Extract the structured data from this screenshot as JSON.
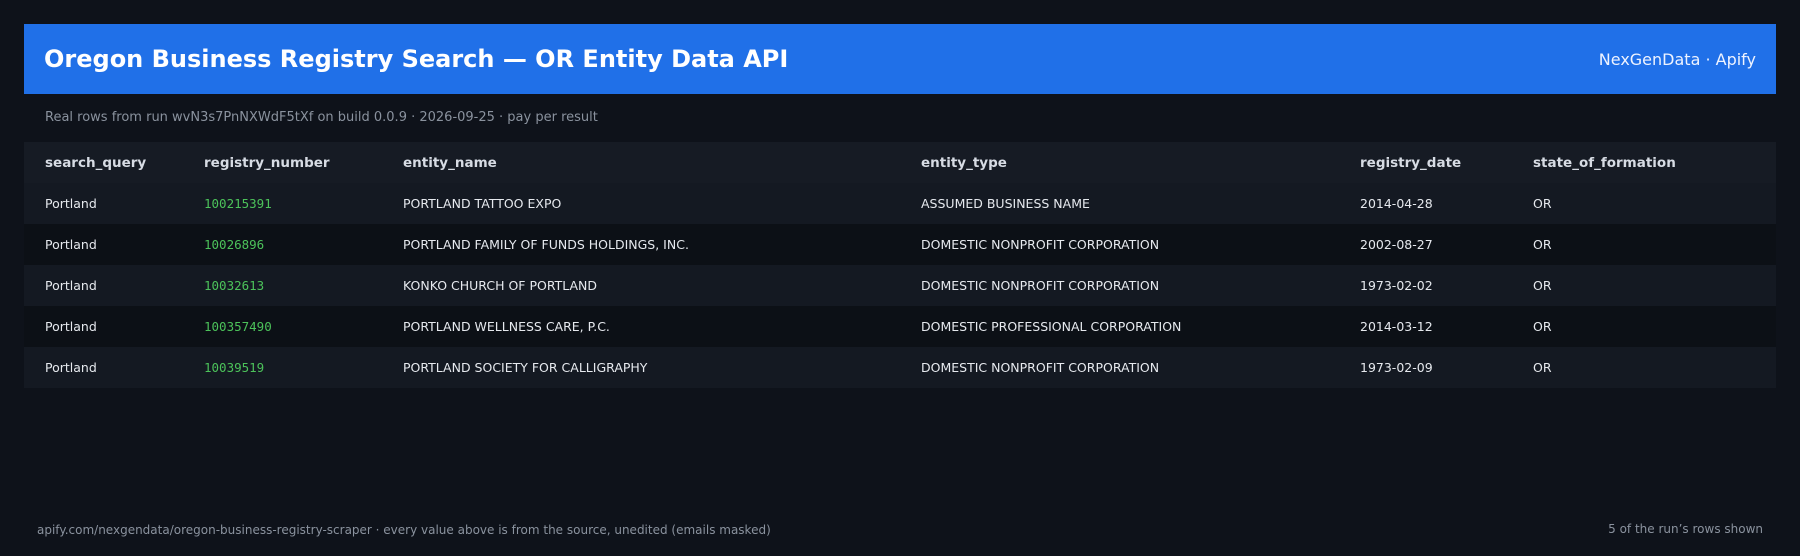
{
  "header": {
    "title": "Oregon Business Registry Search — OR Entity Data API",
    "brand": "NexGenData · Apify"
  },
  "subtitle": "Real rows from run wvN3s7PnNXWdF5tXf on build 0.0.9 · 2026-09-25 · pay per result",
  "table": {
    "columns": [
      "search_query",
      "registry_number",
      "entity_name",
      "entity_type",
      "registry_date",
      "state_of_formation"
    ],
    "rows": [
      [
        "Portland",
        "100215391",
        "PORTLAND TATTOO EXPO",
        "ASSUMED BUSINESS NAME",
        "2014-04-28",
        "OR"
      ],
      [
        "Portland",
        "10026896",
        "PORTLAND FAMILY OF FUNDS HOLDINGS, INC.",
        "DOMESTIC NONPROFIT CORPORATION",
        "2002-08-27",
        "OR"
      ],
      [
        "Portland",
        "10032613",
        "KONKO CHURCH OF PORTLAND",
        "DOMESTIC NONPROFIT CORPORATION",
        "1973-02-02",
        "OR"
      ],
      [
        "Portland",
        "100357490",
        "PORTLAND WELLNESS CARE, P.C.",
        "DOMESTIC PROFESSIONAL CORPORATION",
        "2014-03-12",
        "OR"
      ],
      [
        "Portland",
        "10039519",
        "PORTLAND SOCIETY FOR CALLIGRAPHY",
        "DOMESTIC NONPROFIT CORPORATION",
        "1973-02-09",
        "OR"
      ]
    ]
  },
  "footer": {
    "left": "apify.com/nexgendata/oregon-business-registry-scraper  ·  every value above is from the source, unedited (emails masked)",
    "right": "5 of the run’s rows shown"
  },
  "colors": {
    "header_bg": "#2070e8",
    "page_bg": "#0e121a",
    "registry_number": "#4cc25a"
  }
}
